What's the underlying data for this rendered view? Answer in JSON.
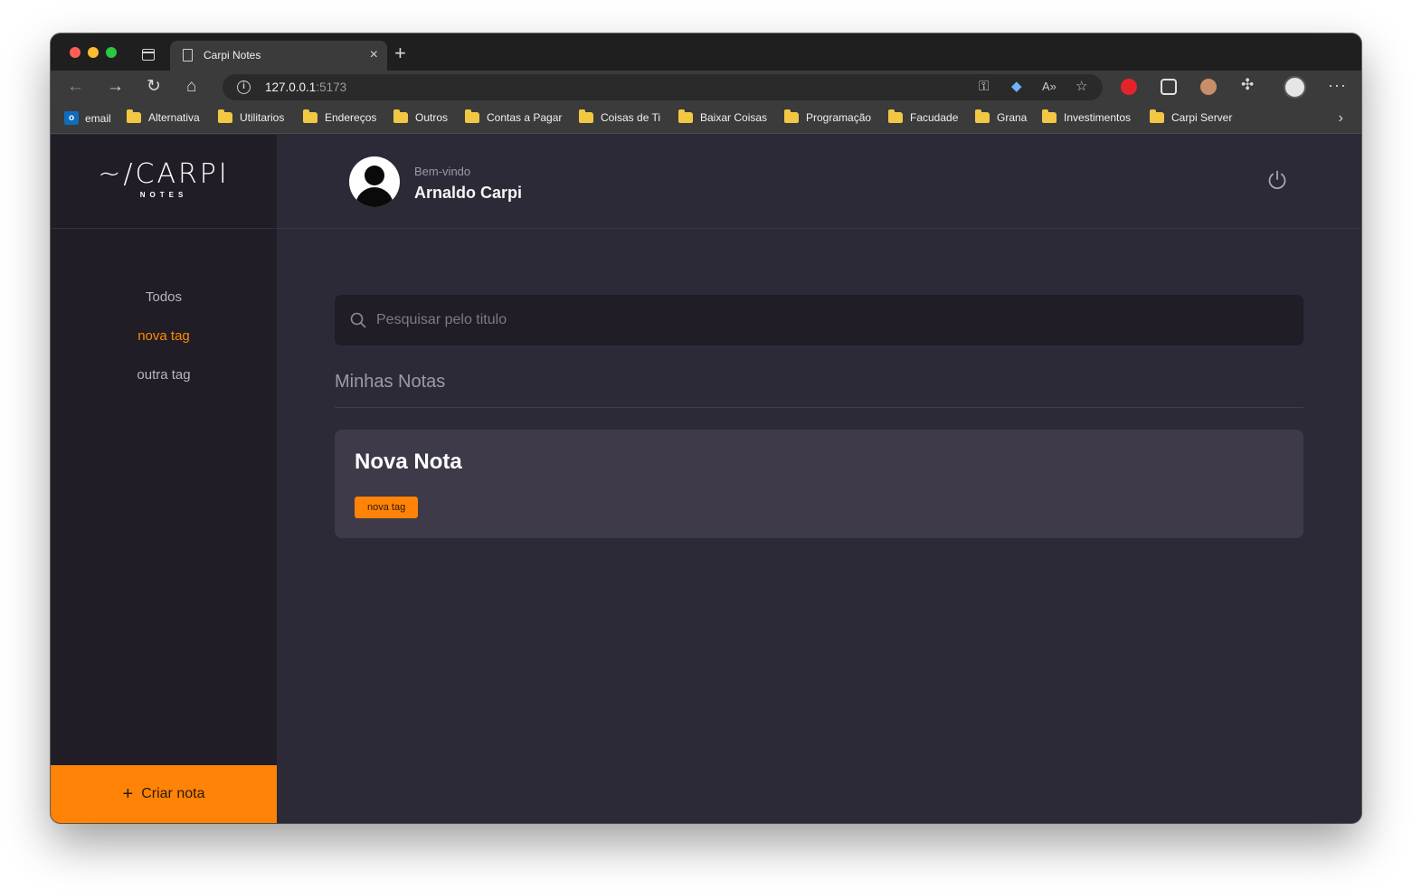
{
  "browser": {
    "tab_title": "Carpi Notes",
    "tab_close": "×",
    "new_tab": "+",
    "url_host": "127.0.0.1",
    "url_port": ":5173",
    "bookmarks": [
      {
        "label": "email",
        "icon": "outlook-icon"
      },
      {
        "label": "Alternativa",
        "icon": "folder-icon"
      },
      {
        "label": "Utilitarios",
        "icon": "folder-icon"
      },
      {
        "label": "Endereços",
        "icon": "folder-icon"
      },
      {
        "label": "Outros",
        "icon": "folder-icon"
      },
      {
        "label": "Contas a Pagar",
        "icon": "folder-icon"
      },
      {
        "label": "Coisas de Ti",
        "icon": "folder-icon"
      },
      {
        "label": "Baixar Coisas",
        "icon": "folder-icon"
      },
      {
        "label": "Programação",
        "icon": "folder-icon"
      },
      {
        "label": "Facudade",
        "icon": "folder-icon"
      },
      {
        "label": "Grana",
        "icon": "folder-icon"
      },
      {
        "label": "Investimentos",
        "icon": "folder-icon"
      },
      {
        "label": "Carpi Server",
        "icon": "folder-icon"
      }
    ]
  },
  "sidebar": {
    "logo": "~/CARPI",
    "logo_sub": "NOTES",
    "tags": [
      {
        "label": "Todos",
        "active": false
      },
      {
        "label": "nova tag",
        "active": true
      },
      {
        "label": "outra tag",
        "active": false
      }
    ],
    "create_button": "Criar nota",
    "create_plus": "+"
  },
  "header": {
    "welcome": "Bem-vindo",
    "username": "Arnaldo Carpi"
  },
  "search": {
    "placeholder": "Pesquisar pelo titulo",
    "value": ""
  },
  "notes_section": {
    "title": "Minhas Notas",
    "notes": [
      {
        "title": "Nova Nota",
        "tags": [
          "nova tag"
        ]
      }
    ]
  },
  "colors": {
    "accent": "#ff8306",
    "sidebar_bg": "#201d27",
    "main_bg": "#2d2a37",
    "card_bg": "#3e3a49"
  }
}
